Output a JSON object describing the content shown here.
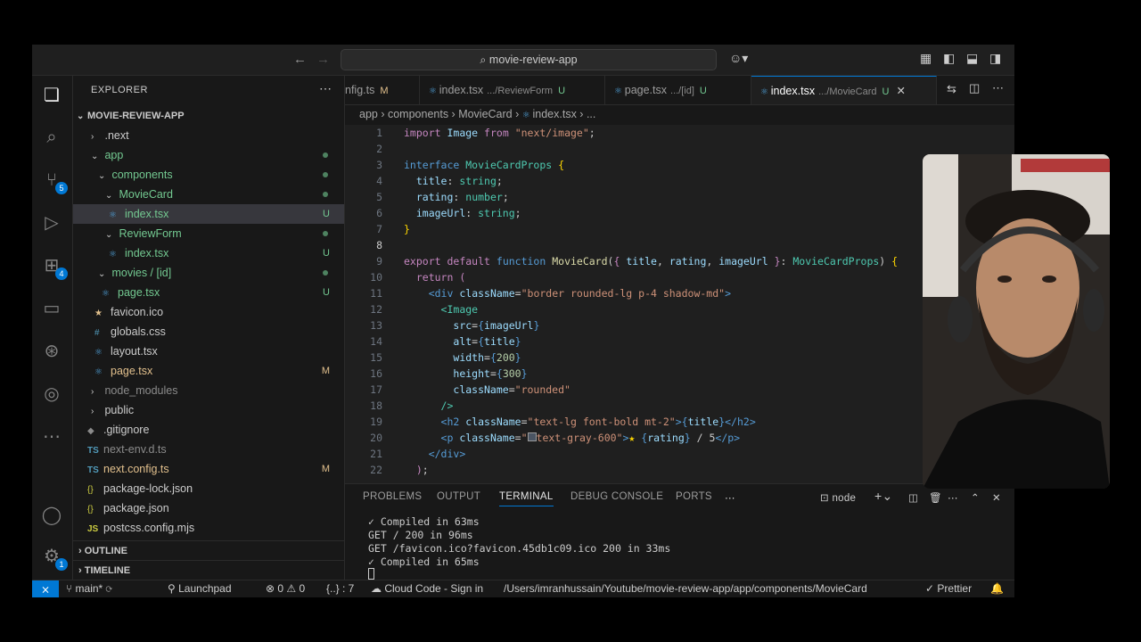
{
  "titlebar": {
    "back_icon": "arrow-left-icon",
    "forward_icon": "arrow-right-icon",
    "search_text": "movie-review-app"
  },
  "activity_bar": {
    "source_control_badge": "5",
    "extensions_badge": "4",
    "settings_badge": "1"
  },
  "explorer": {
    "title": "EXPLORER",
    "root": "MOVIE-REVIEW-APP",
    "items": [
      {
        "label": ".next",
        "status": ""
      },
      {
        "label": "app",
        "status": ""
      },
      {
        "label": "components",
        "status": ""
      },
      {
        "label": "MovieCard",
        "status": ""
      },
      {
        "label": "index.tsx",
        "status": "U"
      },
      {
        "label": "ReviewForm",
        "status": ""
      },
      {
        "label": "index.tsx",
        "status": "U"
      },
      {
        "label": "movies / [id]",
        "status": ""
      },
      {
        "label": "page.tsx",
        "status": "U"
      },
      {
        "label": "favicon.ico",
        "status": ""
      },
      {
        "label": "globals.css",
        "status": ""
      },
      {
        "label": "layout.tsx",
        "status": ""
      },
      {
        "label": "page.tsx",
        "status": "M"
      },
      {
        "label": "node_modules",
        "status": ""
      },
      {
        "label": "public",
        "status": ""
      },
      {
        "label": ".gitignore",
        "status": ""
      },
      {
        "label": "next-env.d.ts",
        "status": ""
      },
      {
        "label": "next.config.ts",
        "status": "M"
      },
      {
        "label": "package-lock.json",
        "status": ""
      },
      {
        "label": "package.json",
        "status": ""
      },
      {
        "label": "postcss.config.mjs",
        "status": ""
      }
    ],
    "outline": "OUTLINE",
    "timeline": "TIMELINE"
  },
  "tabs": [
    {
      "name": "nfig.ts",
      "desc": "",
      "status": "M"
    },
    {
      "name": "index.tsx",
      "desc": ".../ReviewForm",
      "status": "U"
    },
    {
      "name": "page.tsx",
      "desc": ".../[id]",
      "status": "U"
    },
    {
      "name": "index.tsx",
      "desc": ".../MovieCard",
      "status": "U"
    }
  ],
  "breadcrumb": [
    "app",
    "components",
    "MovieCard",
    "index.tsx",
    "..."
  ],
  "code_lines": [
    "1",
    "2",
    "3",
    "4",
    "5",
    "6",
    "7",
    "8",
    "9",
    "10",
    "11",
    "12",
    "13",
    "14",
    "15",
    "16",
    "17",
    "18",
    "19",
    "20",
    "21",
    "22"
  ],
  "panel": {
    "tabs": [
      "PROBLEMS",
      "OUTPUT",
      "TERMINAL",
      "DEBUG CONSOLE",
      "PORTS"
    ],
    "terminal_name": "node",
    "terminal_lines": [
      "✓ Compiled in 63ms",
      "GET / 200 in 96ms",
      "GET /favicon.ico?favicon.45db1c09.ico 200 in 33ms",
      "✓ Compiled in 65ms"
    ]
  },
  "statusbar": {
    "branch": "main*",
    "launchpad": "Launchpad",
    "errors": "0",
    "warnings": "0",
    "braces": "{..} : 7",
    "cloud": "Cloud Code - Sign in",
    "path": "/Users/imranhussain/Youtube/movie-review-app/app/components/MovieCard",
    "prettier": "Prettier"
  }
}
